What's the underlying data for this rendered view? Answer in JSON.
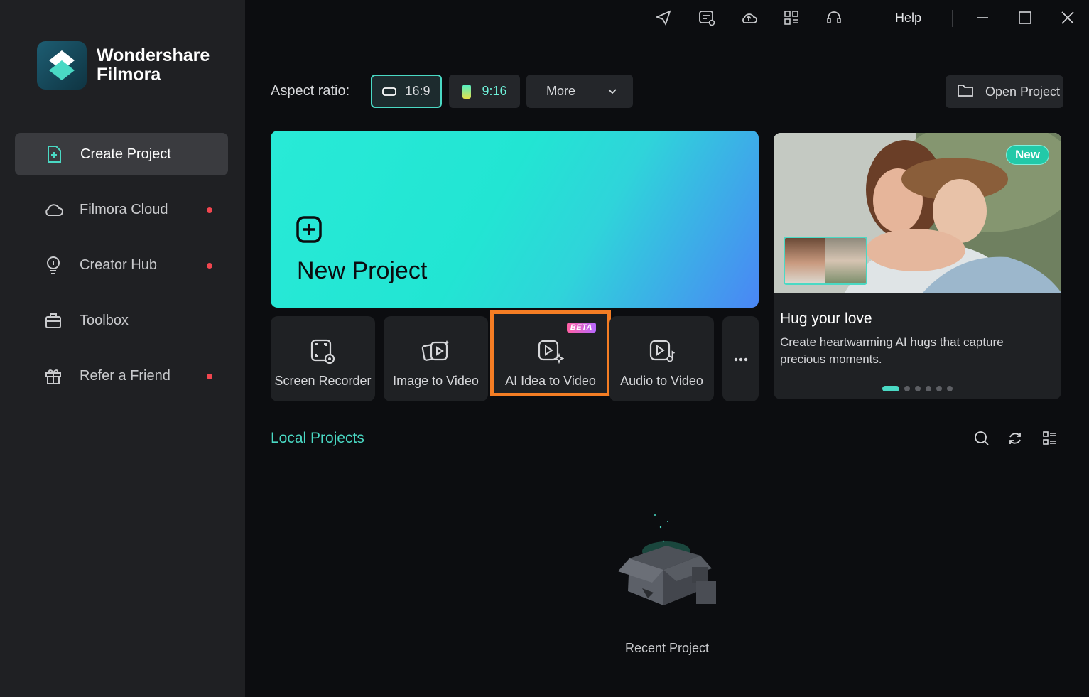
{
  "app": {
    "brand_line1": "Wondershare",
    "brand_line2": "Filmora"
  },
  "sidebar": {
    "items": [
      {
        "label": "Create Project",
        "icon": "create-project-icon",
        "active": true,
        "dot": false
      },
      {
        "label": "Filmora Cloud",
        "icon": "cloud-icon",
        "active": false,
        "dot": true
      },
      {
        "label": "Creator Hub",
        "icon": "lightbulb-icon",
        "active": false,
        "dot": true
      },
      {
        "label": "Toolbox",
        "icon": "toolbox-icon",
        "active": false,
        "dot": false
      },
      {
        "label": "Refer a Friend",
        "icon": "gift-icon",
        "active": false,
        "dot": true
      }
    ]
  },
  "topbar": {
    "icons": [
      "send-icon",
      "feedback-icon",
      "cloud-upload-icon",
      "apps-grid-icon",
      "headset-icon"
    ],
    "help_label": "Help",
    "window_controls": [
      "minimize-icon",
      "maximize-icon",
      "close-icon"
    ]
  },
  "aspect_ratio": {
    "label": "Aspect ratio:",
    "options": [
      {
        "label": "16:9",
        "selected": true
      },
      {
        "label": "9:16",
        "selected": false
      }
    ],
    "more_label": "More"
  },
  "open_project": {
    "label": "Open Project"
  },
  "new_project": {
    "label": "New Project"
  },
  "features": [
    {
      "label": "Screen Recorder",
      "icon": "screen-recorder-icon"
    },
    {
      "label": "Image to Video",
      "icon": "image-to-video-icon"
    },
    {
      "label": "AI Idea to Video",
      "icon": "ai-idea-to-video-icon",
      "badge": "BETA",
      "highlighted": true
    },
    {
      "label": "Audio to Video",
      "icon": "audio-to-video-icon"
    }
  ],
  "promo": {
    "badge": "New",
    "title": "Hug your love",
    "description": "Create heartwarming AI hugs that capture precious moments.",
    "slide_count": 6,
    "active_slide": 1
  },
  "local_projects": {
    "title": "Local Projects",
    "empty_label": "Recent Project",
    "icons": [
      "search-icon",
      "refresh-icon",
      "list-view-icon"
    ]
  },
  "colors": {
    "accent": "#4ad9c4",
    "highlight_border": "#f47d24",
    "notification_dot": "#f2464f"
  }
}
